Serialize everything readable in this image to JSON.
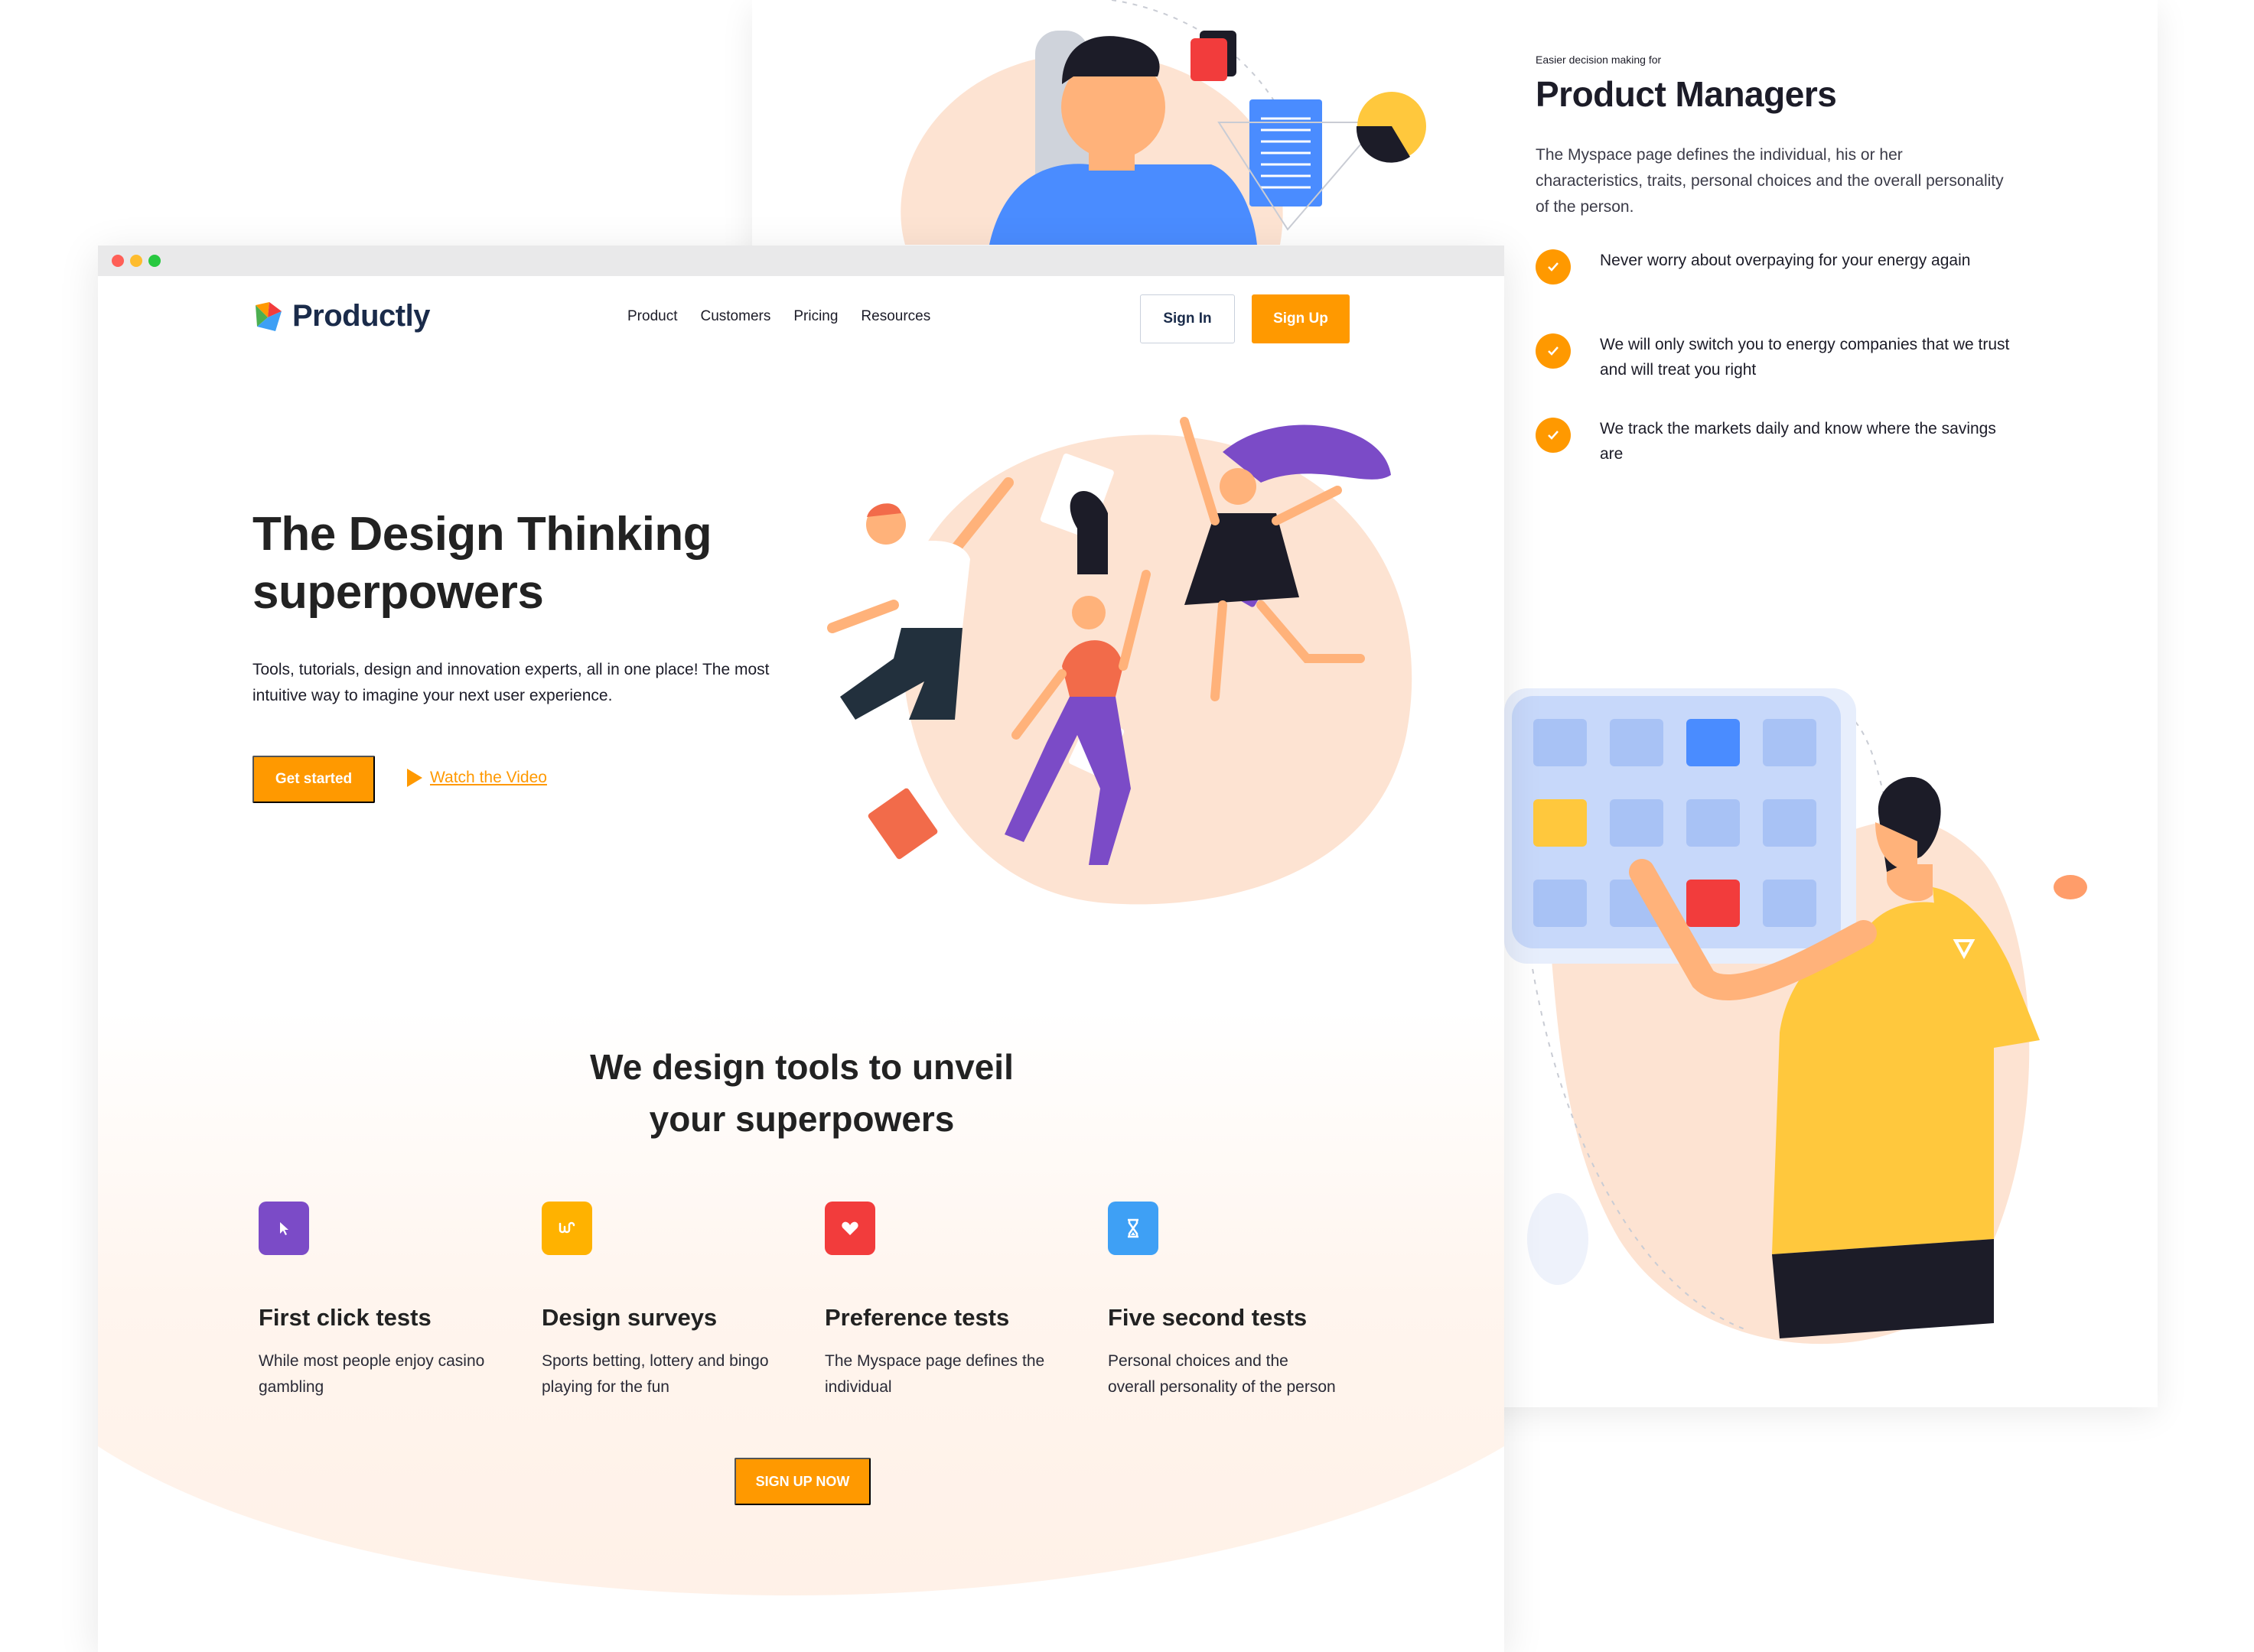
{
  "back": {
    "eyebrow": "Easier decision making for",
    "title": "Product Managers",
    "description": "The Myspace page defines the individual, his or her characteristics, traits, personal choices and the overall personality of the person.",
    "list": [
      "Never worry about overpaying for your energy again",
      "We will only switch you to energy companies that we trust and will treat you right",
      "We track the markets daily and know where the savings are"
    ]
  },
  "window": {
    "dots": [
      "#ff5f57",
      "#febc2e",
      "#28c840"
    ]
  },
  "nav": {
    "brand": "Productly",
    "links": [
      "Product",
      "Customers",
      "Pricing",
      "Resources"
    ],
    "signin": "Sign In",
    "signup": "Sign Up"
  },
  "hero": {
    "title": "The Design Thinking superpowers",
    "subtitle": "Tools, tutorials, design and innovation experts, all in one place! The most intuitive way to imagine your next user experience.",
    "cta": "Get started",
    "video": "Watch the Video"
  },
  "section": {
    "title": "We design tools to unveil your superpowers",
    "features": [
      {
        "title": "First click tests",
        "desc": "While most people enjoy casino gambling",
        "color": "#7b4bc7",
        "icon": "cursor-icon"
      },
      {
        "title": "Design surveys",
        "desc": "Sports betting, lottery and bingo playing for the fun",
        "color": "#ffb200",
        "icon": "survey-icon"
      },
      {
        "title": "Preference tests",
        "desc": "The Myspace page defines the individual",
        "color": "#f23c3c",
        "icon": "heart-icon"
      },
      {
        "title": "Five second tests",
        "desc": "Personal choices and the overall personality of the person",
        "color": "#3ea0f5",
        "icon": "hourglass-icon"
      }
    ],
    "cta": "SIGN UP NOW"
  },
  "colors": {
    "accent": "#ff9900",
    "brand": "#1a2b4a",
    "blob": "#fde3d2"
  }
}
